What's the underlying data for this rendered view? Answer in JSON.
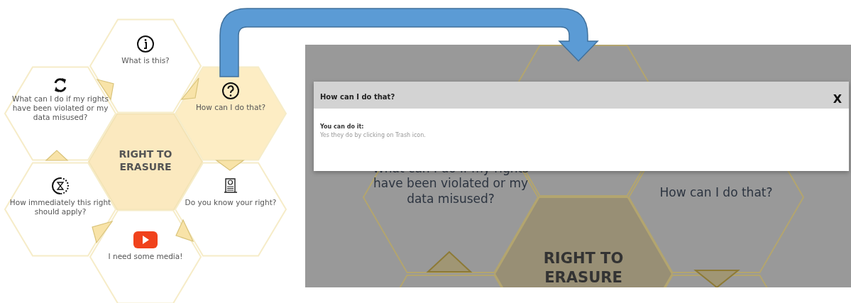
{
  "diagram": {
    "center": "RIGHT TO ERASURE",
    "tiles": [
      {
        "label": "What is this?",
        "selected": false
      },
      {
        "label": "What can I do if my rights have been violated or my data misused?",
        "selected": false
      },
      {
        "label": "How can I do that?",
        "selected": true
      },
      {
        "label": "How immediately this right should apply?",
        "selected": false
      },
      {
        "label": "Do you know your right?",
        "selected": false
      },
      {
        "label": "I need some media!",
        "selected": false
      }
    ]
  },
  "app_screen": {
    "background": {
      "center": "RIGHT TO ERASURE",
      "tiles": [
        {
          "label": "What can I do if my rights have been violated or my data misused?"
        },
        {
          "label": "How can I do that?"
        }
      ]
    },
    "modal": {
      "title": "How can I do that?",
      "close": "X",
      "heading": "You can do it:",
      "text": "Yes they do by clicking on Trash icon."
    }
  }
}
